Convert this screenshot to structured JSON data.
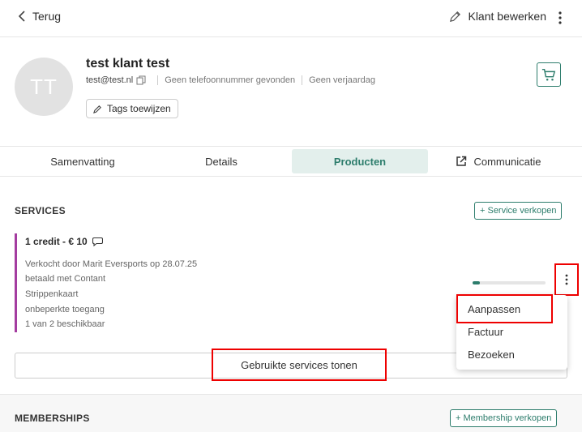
{
  "topbar": {
    "back_label": "Terug",
    "edit_label": "Klant bewerken"
  },
  "customer": {
    "initials": "TT",
    "name": "test klant test",
    "email": "test@test.nl",
    "phone": "Geen telefoonnummer gevonden",
    "birthday": "Geen verjaardag",
    "tags_button": "Tags toewijzen"
  },
  "tabs": [
    {
      "label": "Samenvatting"
    },
    {
      "label": "Details"
    },
    {
      "label": "Producten",
      "active": true
    },
    {
      "label": "Communicatie"
    }
  ],
  "services": {
    "title": "SERVICES",
    "sell_button": "+ Service verkopen",
    "item": {
      "title": "1 credit - € 10",
      "lines": [
        "Verkocht door Marit Eversports op 28.07.25",
        "betaald met Contant",
        "Strippenkaart",
        "onbeperkte toegang",
        "1 van 2 beschikbaar"
      ],
      "usage_fraction": 0.1
    },
    "show_used_button": "Gebruikte services tonen"
  },
  "context_menu": {
    "items": [
      "Aanpassen",
      "Factuur",
      "Bezoeken"
    ]
  },
  "memberships": {
    "title": "MEMBERSHIPS",
    "sell_button": "+ Membership verkopen"
  },
  "colors": {
    "accent": "#2d7d6c",
    "service_bar": "#a43ca0",
    "annotation": "#e00000"
  }
}
